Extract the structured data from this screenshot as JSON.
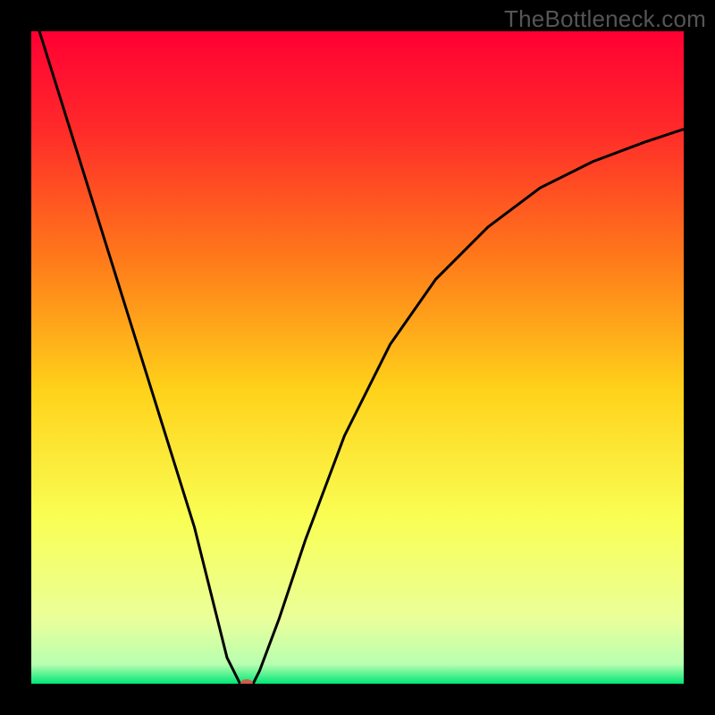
{
  "watermark": "TheBottleneck.com",
  "chart_data": {
    "type": "line",
    "title": "",
    "xlabel": "",
    "ylabel": "",
    "xlim": [
      0,
      100
    ],
    "ylim": [
      0,
      100
    ],
    "grid": false,
    "legend": false,
    "background_gradient": {
      "direction": "vertical",
      "stops": [
        {
          "pos": 0.0,
          "color": "#ff0033"
        },
        {
          "pos": 0.15,
          "color": "#ff2a2a"
        },
        {
          "pos": 0.35,
          "color": "#ff7a1a"
        },
        {
          "pos": 0.55,
          "color": "#ffd21a"
        },
        {
          "pos": 0.75,
          "color": "#f9ff55"
        },
        {
          "pos": 0.9,
          "color": "#eaff9a"
        },
        {
          "pos": 0.97,
          "color": "#b8ffb0"
        },
        {
          "pos": 1.0,
          "color": "#00e676"
        }
      ]
    },
    "series": [
      {
        "name": "bottleneck-curve",
        "color": "#000000",
        "x": [
          0,
          5,
          10,
          15,
          20,
          25,
          28,
          30,
          32,
          33,
          34,
          35,
          38,
          42,
          48,
          55,
          62,
          70,
          78,
          86,
          94,
          100
        ],
        "values": [
          104,
          88,
          72,
          56,
          40,
          24,
          12,
          4,
          0,
          0,
          0,
          2,
          10,
          22,
          38,
          52,
          62,
          70,
          76,
          80,
          83,
          85
        ]
      }
    ],
    "marker": {
      "name": "optimal-point",
      "x": 33,
      "y": 0,
      "color": "#d35a4a",
      "rx": 7,
      "ry": 5
    },
    "annotations": []
  }
}
